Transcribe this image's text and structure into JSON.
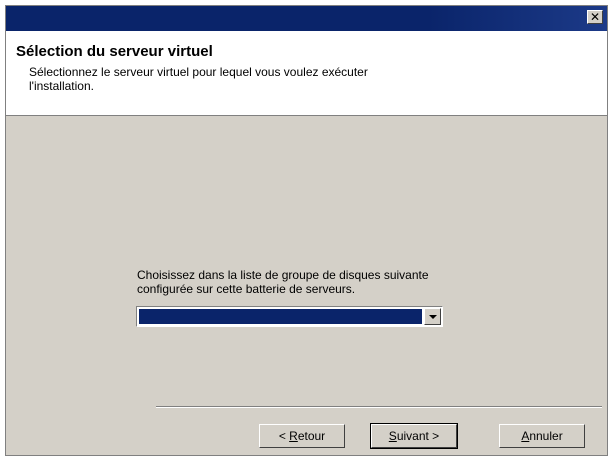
{
  "window": {
    "close_glyph": "✕"
  },
  "header": {
    "title": "Sélection du serveur virtuel",
    "subtitle": "Sélectionnez le serveur virtuel pour lequel vous voulez exécuter l'installation."
  },
  "content": {
    "label": "Choisissez dans la liste de groupe de disques suivante configurée sur cette batterie de serveurs.",
    "combo_selected_value": ""
  },
  "buttons": {
    "back": {
      "prefix": "< ",
      "mnemonic": "R",
      "rest": "etour"
    },
    "next": {
      "mnemonic": "S",
      "rest": "uivant >"
    },
    "cancel": {
      "mnemonic": "A",
      "rest": "nnuler"
    }
  },
  "colors": {
    "titlebar": "#0a246a",
    "dialog_bg": "#d4d0c8",
    "selection": "#0a246a"
  },
  "icons": {
    "close": "close-icon",
    "dropdown": "chevron-down-icon"
  }
}
